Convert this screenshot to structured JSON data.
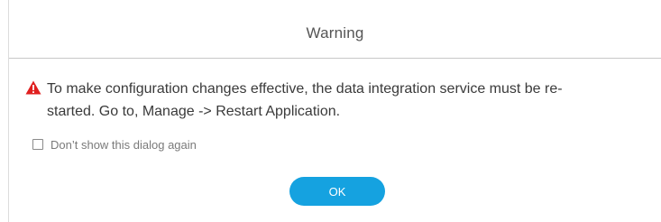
{
  "dialog": {
    "title": "Warning",
    "message_line1": "To make configuration changes effective, the data integration service must be re-",
    "message_line2": "started. Go to, Manage -> Restart Application.",
    "checkbox_label": "Don’t show this dialog again",
    "checkbox_checked": false,
    "ok_label": "OK"
  },
  "colors": {
    "warning_icon": "#e02020",
    "ok_button": "#15a2e0"
  },
  "icons": {
    "warning": "warning-triangle-icon"
  }
}
